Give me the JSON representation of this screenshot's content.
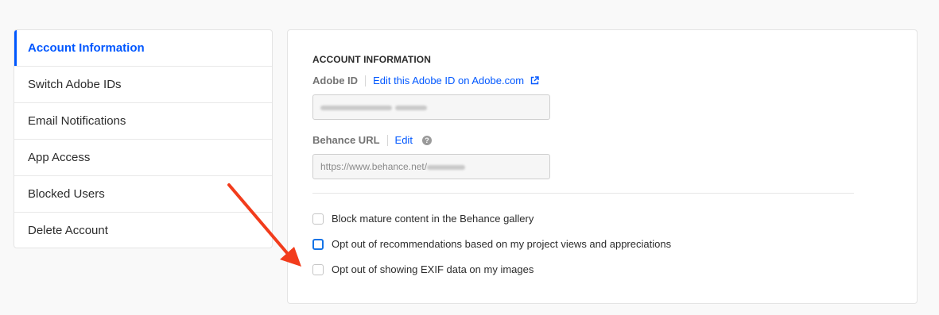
{
  "sidebar": {
    "items": [
      {
        "label": "Account Information",
        "active": true
      },
      {
        "label": "Switch Adobe IDs"
      },
      {
        "label": "Email Notifications"
      },
      {
        "label": "App Access"
      },
      {
        "label": "Blocked Users"
      },
      {
        "label": "Delete Account"
      }
    ]
  },
  "panel": {
    "section_title": "ACCOUNT INFORMATION",
    "adobe_id": {
      "label": "Adobe ID",
      "link_text": "Edit this Adobe ID on Adobe.com",
      "link_icon": "external-link-icon"
    },
    "behance_url": {
      "label": "Behance URL",
      "edit_text": "Edit",
      "help_icon": "question-circle-icon",
      "help_glyph": "?",
      "value_prefix": "https://www.behance.net/"
    },
    "options": [
      {
        "label": "Block mature content in the Behance gallery",
        "checked": false
      },
      {
        "label": "Opt out of recommendations based on my project views and appreciations",
        "checked": false,
        "focused": true
      },
      {
        "label": "Opt out of showing EXIF data on my images",
        "checked": false
      }
    ]
  },
  "annotation": {
    "type": "red-arrow",
    "color": "#f23c1c",
    "points_to": "exif-checkbox"
  },
  "colors": {
    "accent": "#0057ff",
    "focus": "#1473e6",
    "arrow": "#f23c1c"
  }
}
